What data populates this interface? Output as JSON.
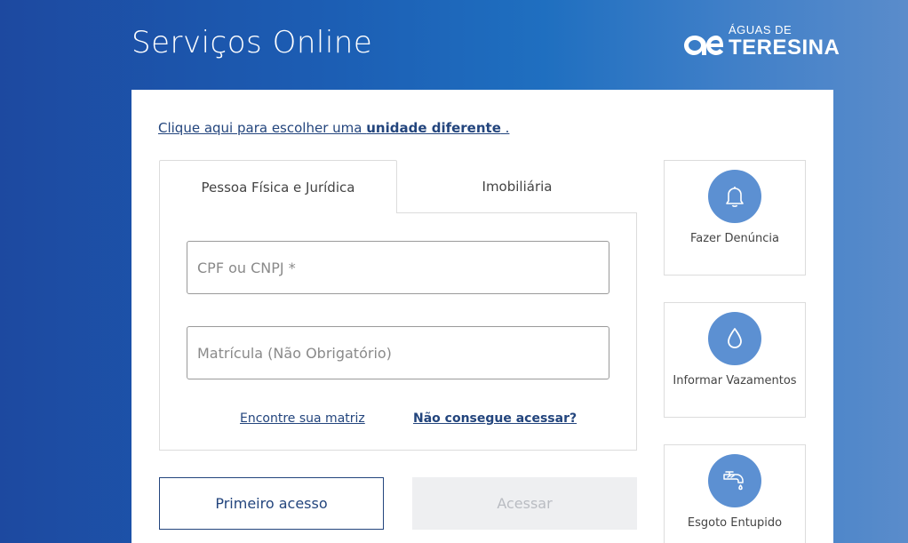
{
  "header": {
    "title": "Serviços Online"
  },
  "logo": {
    "top_text": "ÁGUAS DE",
    "main_text": "TERESINA"
  },
  "card": {
    "unit_link": {
      "prefix": "Clique aqui para escolher uma ",
      "bold": "unidade diferente",
      "suffix": " ."
    },
    "tabs": [
      {
        "label": "Pessoa Física e Jurídica",
        "active": true
      },
      {
        "label": "Imobiliária",
        "active": false
      }
    ],
    "form": {
      "cpf_placeholder": "CPF ou CNPJ *",
      "matricula_placeholder": "Matrícula (Não Obrigatório)",
      "link_matriz": "Encontre sua matriz ",
      "link_acesso": "Não consegue acessar?"
    },
    "buttons": {
      "primeiro_acesso": "Primeiro acesso",
      "acessar": "Acessar"
    },
    "services": [
      {
        "label": "Fazer Denúncia",
        "icon": "bell-icon"
      },
      {
        "label": "Informar Vazamentos",
        "icon": "water-drop-icon"
      },
      {
        "label": "Esgoto Entupido",
        "icon": "faucet-icon"
      }
    ]
  },
  "colors": {
    "accent": "#23457d",
    "service_circle": "#5c90d2"
  }
}
